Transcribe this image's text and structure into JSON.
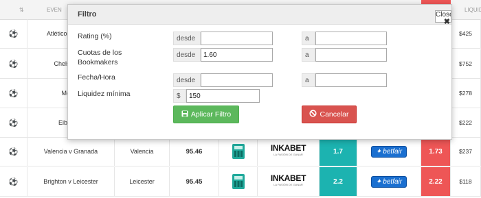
{
  "table": {
    "headers": [
      "EVEN",
      "LIQUID"
    ],
    "rows": [
      {
        "event": "Atlético de ... Esp",
        "selection": "",
        "rating": "",
        "back": "",
        "lay": "",
        "liquidity": "$425"
      },
      {
        "event": "Chelsea v C",
        "selection": "",
        "rating": "",
        "back": "",
        "lay": "",
        "liquidity": "$752"
      },
      {
        "event": "Mónac",
        "selection": "",
        "rating": "",
        "back": "",
        "lay": "",
        "liquidity": "$278"
      },
      {
        "event": "Eibar v F",
        "selection": "",
        "rating": "",
        "back": "",
        "lay": "",
        "liquidity": "$222"
      },
      {
        "event": "Valencia v Granada",
        "selection": "Valencia",
        "rating": "95.46",
        "back": "1.7",
        "lay": "1.73",
        "liquidity": "$237"
      },
      {
        "event": "Brighton v Leicester",
        "selection": "Leicester",
        "rating": "95.45",
        "back": "2.2",
        "lay": "2.22",
        "liquidity": "$118"
      }
    ],
    "bookmaker": "INKABET",
    "bookmaker_tag": "LA PASIÓN DE GANAR",
    "exchange": "betfair",
    "ball_icon": "soccer-ball-icon",
    "calculator_icon": "calculator-icon"
  },
  "modal": {
    "title": "Filtro",
    "close_label": "Close",
    "fields": {
      "rating": {
        "label": "Rating (%)",
        "from_addon": "desde",
        "from_value": "",
        "to_addon": "a",
        "to_value": ""
      },
      "odds": {
        "label_line1": "Cuotas de los",
        "label_line2": "Bookmakers",
        "from_addon": "desde",
        "from_value": "1.60",
        "to_addon": "a",
        "to_value": ""
      },
      "date": {
        "label": "Fecha/Hora",
        "from_addon": "desde",
        "from_value": "",
        "to_addon": "a",
        "to_value": ""
      },
      "liquidity": {
        "label": "Liquidez mínima",
        "addon": "$",
        "value": "150"
      }
    },
    "apply_label": "Aplicar Filtro",
    "cancel_label": "Cancelar"
  },
  "colors": {
    "teal": "#1cb3b0",
    "red": "#ee5656",
    "green": "#5cb85c",
    "betfair": "#1a6fd0"
  }
}
